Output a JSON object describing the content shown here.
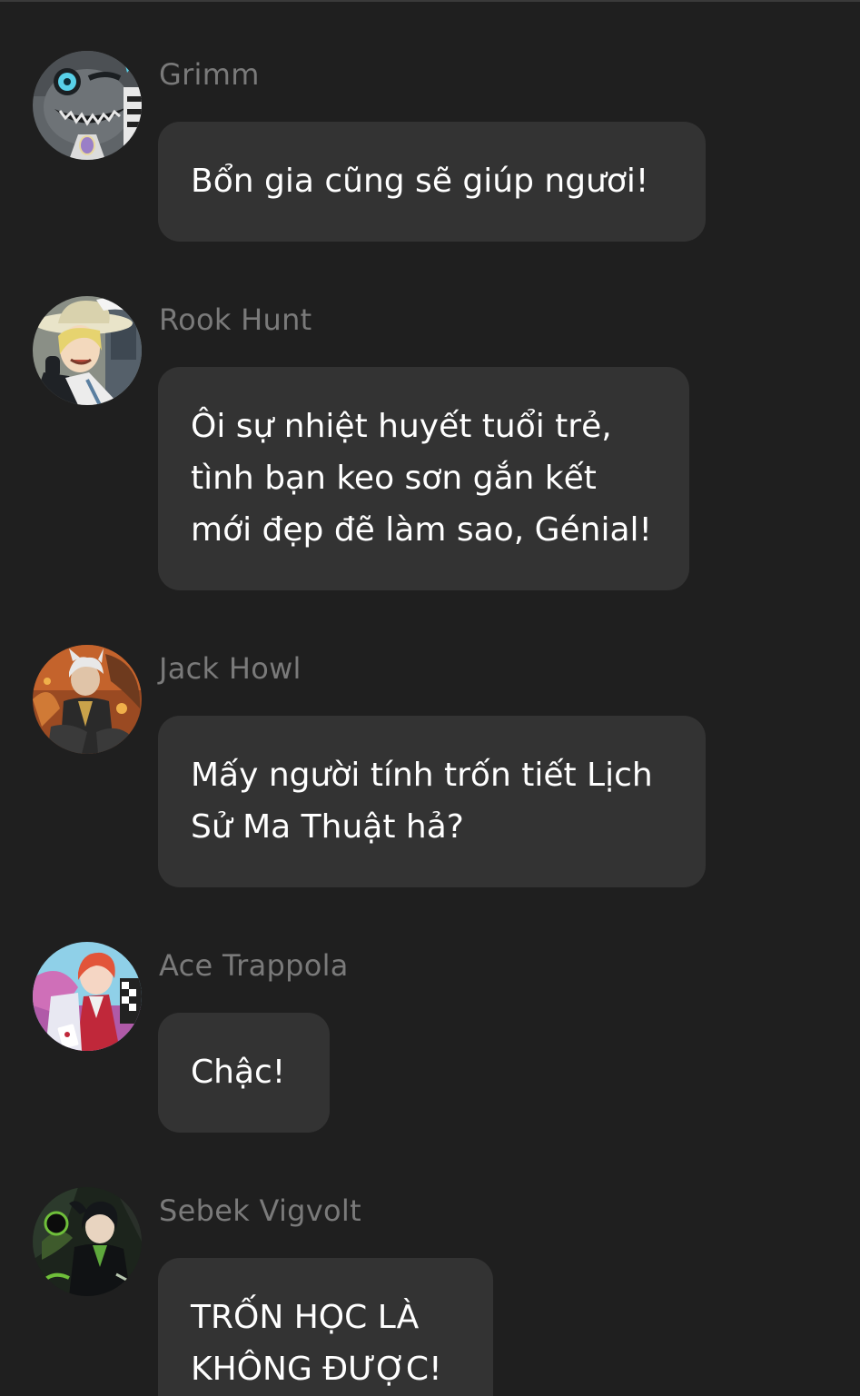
{
  "messages": [
    {
      "sender": "Grimm",
      "avatar_icon": "grimm-cat-avatar-icon",
      "lines": [
        "Bổn gia cũng sẽ giúp ngươi!"
      ]
    },
    {
      "sender": "Rook Hunt",
      "avatar_icon": "rook-hunt-avatar-icon",
      "lines": [
        "Ôi sự nhiệt huyết tuổi trẻ,",
        "tình bạn keo sơn gắn kết",
        "mới đẹp đẽ làm sao, Génial!"
      ]
    },
    {
      "sender": "Jack Howl",
      "avatar_icon": "jack-howl-avatar-icon",
      "lines": [
        "Mấy người tính trốn tiết Lịch",
        "Sử Ma Thuật hả?"
      ]
    },
    {
      "sender": "Ace Trappola",
      "avatar_icon": "ace-trappola-avatar-icon",
      "lines": [
        "Chậc!"
      ]
    },
    {
      "sender": "Sebek Vigvolt",
      "avatar_icon": "sebek-vigvolt-avatar-icon",
      "lines": [
        "TRỐN HỌC LÀ",
        "KHÔNG ĐƯỢC!"
      ]
    }
  ],
  "colors": {
    "background": "#1f1f1f",
    "bubble": "#333333",
    "sender_name": "#7a7a7a",
    "message_text": "#ffffff"
  }
}
